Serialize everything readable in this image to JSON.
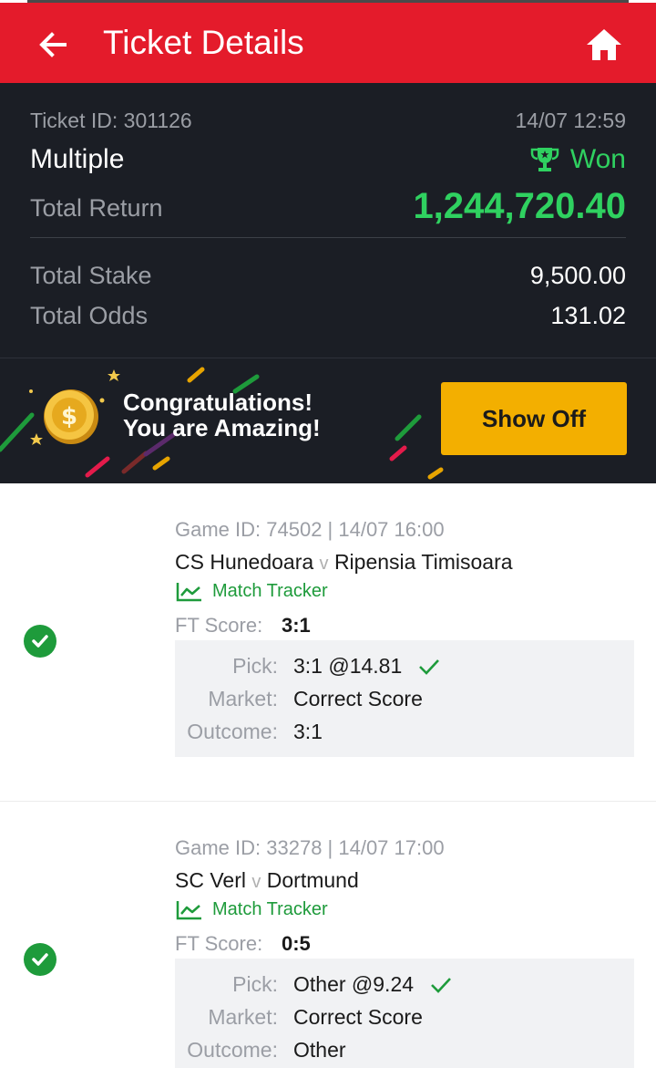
{
  "header": {
    "title": "Ticket Details"
  },
  "ticket": {
    "id_text": "Ticket ID: 301126",
    "time": "14/07 12:59",
    "bet_type": "Multiple",
    "status": "Won",
    "total_return_label": "Total Return",
    "total_return": "1,244,720.40",
    "total_stake_label": "Total Stake",
    "total_stake": "9,500.00",
    "total_odds_label": "Total Odds",
    "total_odds": "131.02"
  },
  "banner": {
    "line1": "Congratulations!",
    "line2": "You are Amazing!",
    "button_label": "Show Off"
  },
  "labels": {
    "vs": "v",
    "match_tracker": "Match Tracker",
    "ft_score": "FT Score:",
    "pick": "Pick:",
    "market": "Market:",
    "outcome": "Outcome:"
  },
  "games": [
    {
      "meta": "Game ID: 74502 | 14/07 16:00",
      "home": "CS Hunedoara",
      "away": "Ripensia Timisoara",
      "ft_score": "3:1",
      "pick": "3:1 @14.81",
      "market": "Correct Score",
      "outcome": "3:1"
    },
    {
      "meta": "Game ID: 33278 | 14/07 17:00",
      "home": "SC Verl",
      "away": "Dortmund",
      "ft_score": "0:5",
      "pick": "Other @9.24",
      "market": "Correct Score",
      "outcome": "Other"
    }
  ],
  "colors": {
    "brand_red": "#e41b2b",
    "dark_bg": "#1b1e25",
    "win_green": "#2fd160",
    "check_green": "#1e9b3b",
    "button_yellow": "#f3af00"
  },
  "icons": [
    "back-arrow-icon",
    "home-icon",
    "trophy-icon",
    "coin-icon",
    "chart-tracker-icon",
    "check-circle-icon",
    "checkmark-icon"
  ]
}
